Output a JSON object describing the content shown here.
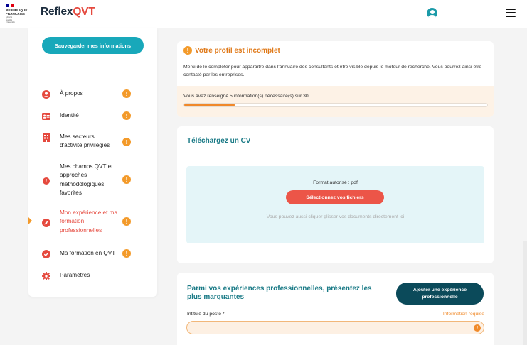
{
  "header": {
    "gov": {
      "line1": "RÉPUBLIQUE",
      "line2": "FRANÇAISE",
      "motto": [
        "Liberté",
        "Égalité",
        "Fraternité"
      ]
    },
    "brand_part1": "Reflex",
    "brand_part2": "QVT",
    "brand_colors": {
      "dark": "#1a2b3c",
      "accent": "#e5493e"
    },
    "user_icon": "user-circle-icon",
    "menu_icon": "hamburger-menu-icon"
  },
  "sidebar": {
    "save_label": "Sauvegarder mes informations",
    "items": [
      {
        "label": "À propos",
        "icon": "user-circle-icon",
        "warning": "!"
      },
      {
        "label": "Identité",
        "icon": "id-card-icon",
        "warning": "!"
      },
      {
        "label": "Mes secteurs d'activité privilégiés",
        "icon": "building-icon",
        "warning": "!"
      },
      {
        "label": "Mes champs QVT et approches méthodologiques favorites",
        "icon": "alert-circle-icon",
        "warning": "!"
      },
      {
        "label": "Mon expérience et ma formation professionnelles",
        "icon": "compass-icon",
        "warning": "!",
        "active": true
      },
      {
        "label": "Ma formation en QVT",
        "icon": "check-circle-icon",
        "warning": "!"
      },
      {
        "label": "Paramètres",
        "icon": "gear-icon"
      }
    ]
  },
  "profile": {
    "warning": "!",
    "title": "Votre profil est incomplet",
    "description": "Merci de le compléter pour apparaître dans l'annuaire des consultants et être visible depuis le moteur de recherche. Vous pourrez ainsi être contacté par les entreprises.",
    "progress_text": "Vous avez renseigné 5 information(s) nécessaire(s) sur 30.",
    "progress_fraction": 0.167
  },
  "cv": {
    "title": "Téléchargez un CV",
    "format": "Format autorisé : pdf",
    "select_label": "Sélectionnez vos fichiers",
    "hint": "Vous pouvez aussi cliquer glisser vos documents directement ici"
  },
  "experience": {
    "title": "Parmi vos expériences professionnelles, présentez les plus marquantes",
    "add_label": "Ajouter une expérience professionnelle",
    "job_title_label": "Intitulé du poste *",
    "required_label": "Information requise",
    "job_title_value": "",
    "warning": "!"
  }
}
